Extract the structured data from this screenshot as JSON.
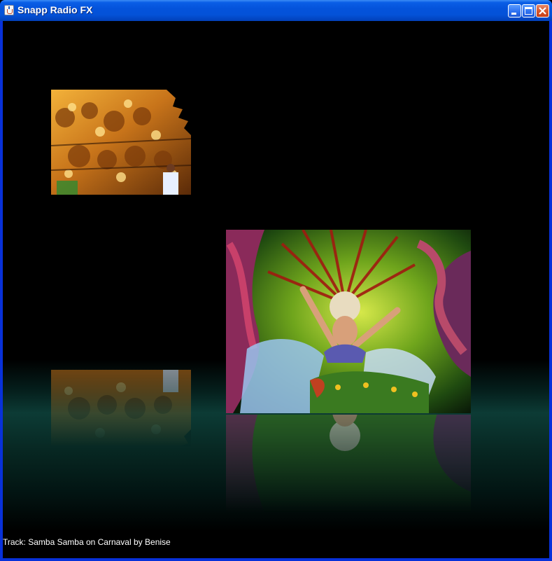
{
  "window": {
    "title": "Snapp Radio FX",
    "icon": "java-cup-icon",
    "controls": {
      "minimize_icon": "minimize-icon",
      "maximize_icon": "maximize-icon",
      "close_icon": "close-icon"
    },
    "titlebar_color": "#0453db"
  },
  "player": {
    "background_color": "#000000",
    "floor_color": "#0c3b35",
    "photos": [
      {
        "name": "carnival-float-photo",
        "state": "inactive"
      },
      {
        "name": "samba-dancer-photo",
        "state": "active"
      }
    ],
    "status": {
      "track_prefix": "Track:",
      "track_title": "Samba Samba on Carnaval",
      "by_word": "by",
      "artist": "Benise"
    }
  }
}
